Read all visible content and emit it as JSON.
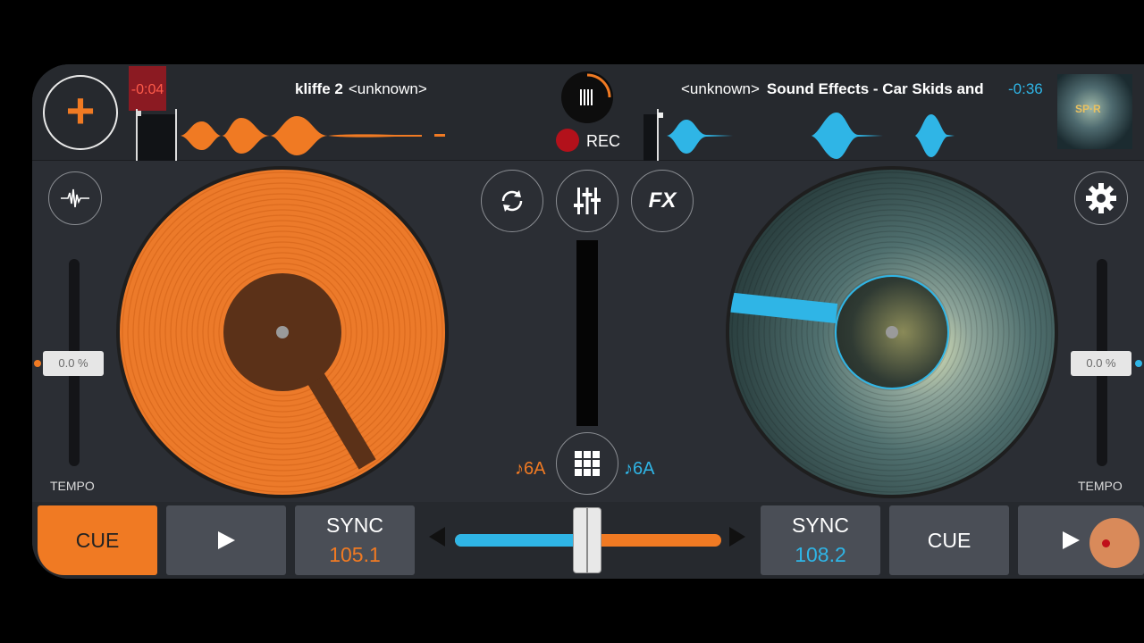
{
  "deck_left": {
    "time_remaining": "-0:04",
    "track_title": "kliffe 2",
    "track_artist": "<unknown>",
    "tempo_value": "0.0 %",
    "tempo_label": "TEMPO",
    "key": "♪6A",
    "accent_color": "#f07a23"
  },
  "deck_right": {
    "artist": "<unknown>",
    "track_title": "Sound Effects - Car Skids and",
    "time_remaining": "-0:36",
    "tempo_value": "0.0 %",
    "tempo_label": "TEMPO",
    "key": "♪6A",
    "accent_color": "#2fb5e6",
    "cover_text": "SP·R"
  },
  "top": {
    "add_icon": "+",
    "rec_label": "REC"
  },
  "mixer": {
    "fx_label": "FX",
    "crossfader_position": 0.5
  },
  "bottom": {
    "left_cue": "CUE",
    "left_sync": "SYNC",
    "left_bpm": "105.1",
    "right_sync": "SYNC",
    "right_bpm": "108.2",
    "right_cue": "CUE"
  }
}
